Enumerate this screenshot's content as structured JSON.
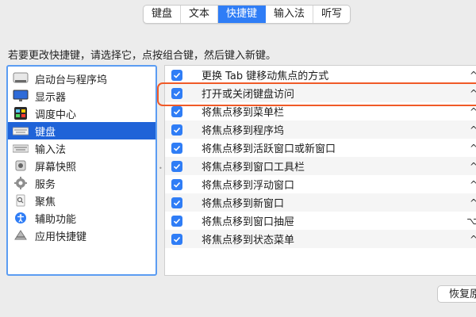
{
  "tabs": [
    {
      "label": "键盘",
      "active": false
    },
    {
      "label": "文本",
      "active": false
    },
    {
      "label": "快捷键",
      "active": true
    },
    {
      "label": "输入法",
      "active": false
    },
    {
      "label": "听写",
      "active": false
    }
  ],
  "instruction": "若要更改快捷键，请选择它，点按组合键，然后键入新键。",
  "categories": [
    {
      "label": "启动台与程序坞",
      "icon": "launchpad-dock-icon"
    },
    {
      "label": "显示器",
      "icon": "display-icon"
    },
    {
      "label": "调度中心",
      "icon": "mission-control-icon"
    },
    {
      "label": "键盘",
      "icon": "keyboard-icon",
      "selected": true
    },
    {
      "label": "输入法",
      "icon": "input-source-icon"
    },
    {
      "label": "屏幕快照",
      "icon": "screenshot-icon"
    },
    {
      "label": "服务",
      "icon": "gear-icon"
    },
    {
      "label": "聚焦",
      "icon": "spotlight-icon"
    },
    {
      "label": "辅助功能",
      "icon": "accessibility-icon"
    },
    {
      "label": "应用快捷键",
      "icon": "app-shortcuts-icon"
    }
  ],
  "shortcuts": [
    {
      "label": "更换 Tab 键移动焦点的方式",
      "key": "^",
      "checked": true
    },
    {
      "label": "打开或关闭键盘访问",
      "key": "^",
      "checked": true,
      "highlighted": true
    },
    {
      "label": "将焦点移到菜单栏",
      "key": "^",
      "checked": true
    },
    {
      "label": "将焦点移到程序坞",
      "key": "^",
      "checked": true
    },
    {
      "label": "将焦点移到活跃窗口或新窗口",
      "key": "^",
      "checked": true
    },
    {
      "label": "将焦点移到窗口工具栏",
      "key": "^",
      "checked": true
    },
    {
      "label": "将焦点移到浮动窗口",
      "key": "^",
      "checked": true
    },
    {
      "label": "将焦点移到新窗口",
      "key": "^",
      "checked": true
    },
    {
      "label": "将焦点移到窗口抽屉",
      "key": "⌥",
      "checked": true
    },
    {
      "label": "将焦点移到状态菜单",
      "key": "^",
      "checked": true
    }
  ],
  "restore_button": "恢复原",
  "colors": {
    "accent": "#2f7df6",
    "selection": "#1f63d8",
    "highlight": "#f05a28"
  }
}
